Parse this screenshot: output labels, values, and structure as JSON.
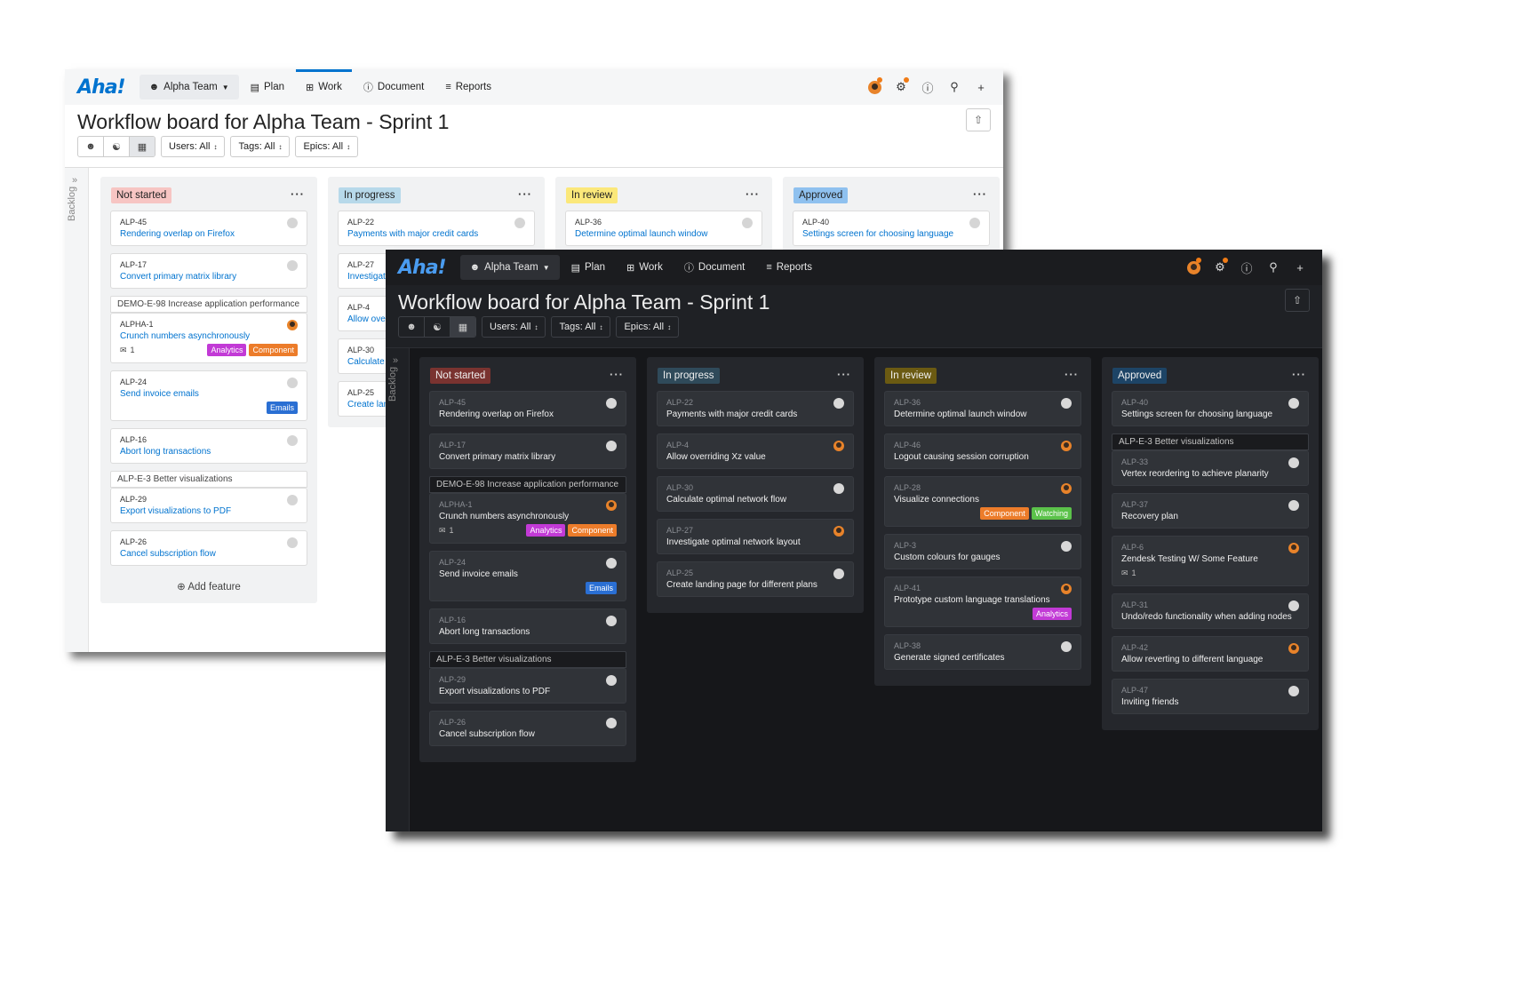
{
  "app": {
    "logo": "Aha!",
    "team": "Alpha Team",
    "nav": [
      "Plan",
      "Work",
      "Document",
      "Reports"
    ],
    "active_nav": "Work"
  },
  "page": {
    "title": "Workflow board for Alpha Team - Sprint 1"
  },
  "filters": {
    "users": "Users: All",
    "tags": "Tags: All",
    "epics": "Epics: All"
  },
  "backlog_label": "Backlog",
  "add_feature_label": "Add feature",
  "colors": {
    "not_started_light": "#f7c5c3",
    "in_progress_light": "#b7d9ea",
    "in_review_light": "#fbe87a",
    "approved_light": "#8fc1ef",
    "not_started_dark": "#7a3330",
    "in_progress_dark": "#2f4a5a",
    "in_review_dark": "#6b5a12",
    "approved_dark": "#1d4466",
    "analytics": "#c23ad6",
    "component": "#ec7c2a",
    "emails": "#2a6fd3",
    "watching": "#5bc24a"
  },
  "light": {
    "columns": [
      {
        "status": "Not started",
        "items": [
          {
            "type": "card",
            "id": "ALP-45",
            "title": "Rendering overlap on Firefox",
            "avatar": "blank"
          },
          {
            "type": "card",
            "id": "ALP-17",
            "title": "Convert primary matrix library",
            "avatar": "blank"
          },
          {
            "type": "epic",
            "name": "DEMO-E-98 Increase application performance",
            "cards": [
              {
                "id": "ALPHA-1",
                "title": "Crunch numbers asynchronously",
                "avatar": "person",
                "comments": "1",
                "tags": [
                  "Analytics",
                  "Component"
                ]
              }
            ]
          },
          {
            "type": "card",
            "id": "ALP-24",
            "title": "Send invoice emails",
            "avatar": "blank",
            "tags": [
              "Emails"
            ]
          },
          {
            "type": "card",
            "id": "ALP-16",
            "title": "Abort long transactions",
            "avatar": "blank"
          },
          {
            "type": "epic",
            "name": "ALP-E-3 Better visualizations",
            "cards": [
              {
                "id": "ALP-29",
                "title": "Export visualizations to PDF",
                "avatar": "blank"
              }
            ]
          },
          {
            "type": "card",
            "id": "ALP-26",
            "title": "Cancel subscription flow",
            "avatar": "blank"
          }
        ]
      },
      {
        "status": "In progress",
        "items": [
          {
            "type": "card",
            "id": "ALP-22",
            "title": "Payments with major credit cards",
            "avatar": "blank"
          },
          {
            "type": "card",
            "id": "ALP-27",
            "title": "Investigate optimal network layout",
            "avatar": "person"
          },
          {
            "type": "card",
            "id": "ALP-4",
            "title": "Allow overriding Xz value",
            "avatar": "person"
          },
          {
            "type": "card",
            "id": "ALP-30",
            "title": "Calculate optimal network flow",
            "avatar": "blank"
          },
          {
            "type": "card",
            "id": "ALP-25",
            "title": "Create landing page for different plans",
            "avatar": "blank"
          }
        ]
      },
      {
        "status": "In review",
        "items": [
          {
            "type": "card",
            "id": "ALP-36",
            "title": "Determine optimal launch window",
            "avatar": "blank"
          }
        ]
      },
      {
        "status": "Approved",
        "items": [
          {
            "type": "card",
            "id": "ALP-40",
            "title": "Settings screen for choosing language",
            "avatar": "blank"
          }
        ]
      }
    ]
  },
  "dark": {
    "columns": [
      {
        "status": "Not started",
        "items": [
          {
            "type": "card",
            "id": "ALP-45",
            "title": "Rendering overlap on Firefox",
            "avatar": "blank"
          },
          {
            "type": "card",
            "id": "ALP-17",
            "title": "Convert primary matrix library",
            "avatar": "blank"
          },
          {
            "type": "epic",
            "name": "DEMO-E-98 Increase application performance",
            "cards": [
              {
                "id": "ALPHA-1",
                "title": "Crunch numbers asynchronously",
                "avatar": "person",
                "comments": "1",
                "tags": [
                  "Analytics",
                  "Component"
                ]
              }
            ]
          },
          {
            "type": "card",
            "id": "ALP-24",
            "title": "Send invoice emails",
            "avatar": "blank",
            "tags": [
              "Emails"
            ]
          },
          {
            "type": "card",
            "id": "ALP-16",
            "title": "Abort long transactions",
            "avatar": "blank"
          },
          {
            "type": "epic",
            "name": "ALP-E-3 Better visualizations",
            "cards": [
              {
                "id": "ALP-29",
                "title": "Export visualizations to PDF",
                "avatar": "blank"
              }
            ]
          },
          {
            "type": "card",
            "id": "ALP-26",
            "title": "Cancel subscription flow",
            "avatar": "blank"
          }
        ]
      },
      {
        "status": "In progress",
        "items": [
          {
            "type": "card",
            "id": "ALP-22",
            "title": "Payments with major credit cards",
            "avatar": "blank"
          },
          {
            "type": "card",
            "id": "ALP-4",
            "title": "Allow overriding Xz value",
            "avatar": "person"
          },
          {
            "type": "card",
            "id": "ALP-30",
            "title": "Calculate optimal network flow",
            "avatar": "blank"
          },
          {
            "type": "card",
            "id": "ALP-27",
            "title": "Investigate optimal network layout",
            "avatar": "person"
          },
          {
            "type": "card",
            "id": "ALP-25",
            "title": "Create landing page for different plans",
            "avatar": "blank"
          }
        ]
      },
      {
        "status": "In review",
        "items": [
          {
            "type": "card",
            "id": "ALP-36",
            "title": "Determine optimal launch window",
            "avatar": "blank"
          },
          {
            "type": "card",
            "id": "ALP-46",
            "title": "Logout causing session corruption",
            "avatar": "person"
          },
          {
            "type": "card",
            "id": "ALP-28",
            "title": "Visualize connections",
            "avatar": "person",
            "tags": [
              "Component",
              "Watching"
            ]
          },
          {
            "type": "card",
            "id": "ALP-3",
            "title": "Custom colours for gauges",
            "avatar": "blank"
          },
          {
            "type": "card",
            "id": "ALP-41",
            "title": "Prototype custom language translations",
            "avatar": "person",
            "tags": [
              "Analytics"
            ]
          },
          {
            "type": "card",
            "id": "ALP-38",
            "title": "Generate signed certificates",
            "avatar": "blank"
          }
        ]
      },
      {
        "status": "Approved",
        "items": [
          {
            "type": "card",
            "id": "ALP-40",
            "title": "Settings screen for choosing language",
            "avatar": "blank"
          },
          {
            "type": "epic",
            "name": "ALP-E-3 Better visualizations",
            "cards": [
              {
                "id": "ALP-33",
                "title": "Vertex reordering to achieve planarity",
                "avatar": "blank"
              }
            ]
          },
          {
            "type": "card",
            "id": "ALP-37",
            "title": "Recovery plan",
            "avatar": "blank"
          },
          {
            "type": "card",
            "id": "ALP-6",
            "title": "Zendesk Testing W/ Some Feature",
            "avatar": "person",
            "comments": "1"
          },
          {
            "type": "card",
            "id": "ALP-31",
            "title": "Undo/redo functionality when adding nodes",
            "avatar": "blank"
          },
          {
            "type": "card",
            "id": "ALP-42",
            "title": "Allow reverting to different language",
            "avatar": "person"
          },
          {
            "type": "card",
            "id": "ALP-47",
            "title": "Inviting friends",
            "avatar": "blank"
          }
        ]
      }
    ]
  }
}
